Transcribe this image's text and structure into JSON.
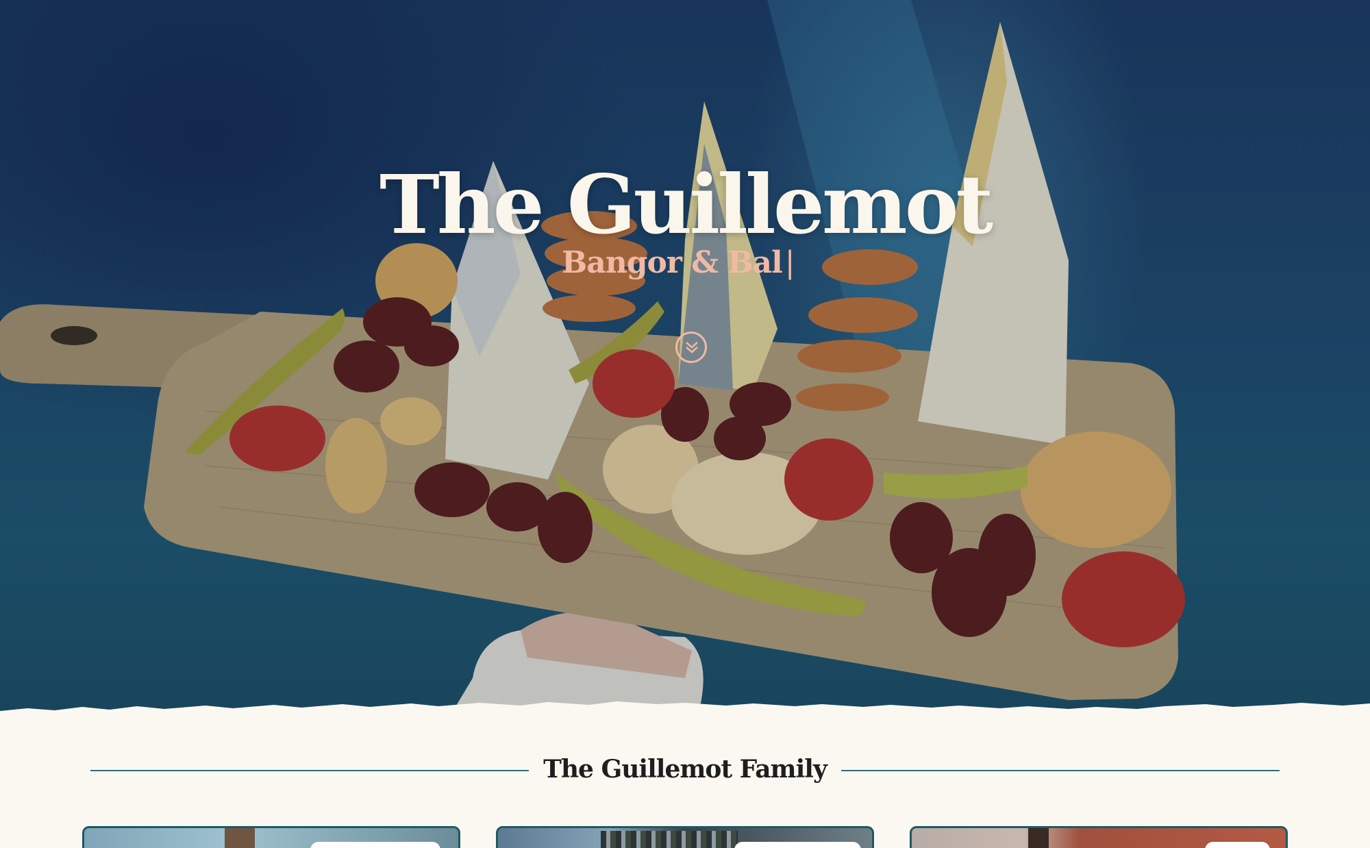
{
  "hero": {
    "title": "The Guillemot",
    "subtitle": "Bangor & Bal",
    "caret": "|",
    "scroll_icon": "double-chevron-down-icon"
  },
  "family_section": {
    "heading": "The Guillemot Family",
    "cards": [
      {
        "name": "venue-card-1"
      },
      {
        "name": "venue-card-2"
      },
      {
        "name": "venue-card-3"
      }
    ]
  },
  "colors": {
    "cream": "#fbf8f2",
    "title_cream": "#fbf6ec",
    "salmon_accent": "#f1b9a3",
    "teal_rule": "#2f6a78",
    "card_border": "#1d5a63",
    "heading_dark": "#1e1e1e"
  }
}
